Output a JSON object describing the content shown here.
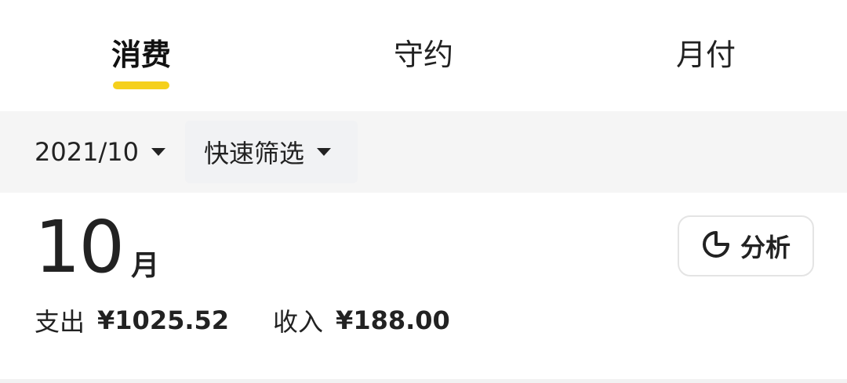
{
  "tabs": [
    {
      "label": "消费",
      "active": true
    },
    {
      "label": "守约",
      "active": false
    },
    {
      "label": "月付",
      "active": false
    }
  ],
  "filters": {
    "month": "2021/10",
    "quick_filter": "快速筛选"
  },
  "summary": {
    "month_number": "10",
    "month_unit": "月",
    "analyze_label": "分析",
    "expense_label": "支出",
    "expense_value": "¥1025.52",
    "income_label": "收入",
    "income_value": "¥188.00"
  },
  "icons": {
    "analyze": "pie-chart-icon",
    "dropdown": "caret-down-icon"
  },
  "colors": {
    "accent": "#f5d01c",
    "filter_bg": "#f5f5f5"
  }
}
